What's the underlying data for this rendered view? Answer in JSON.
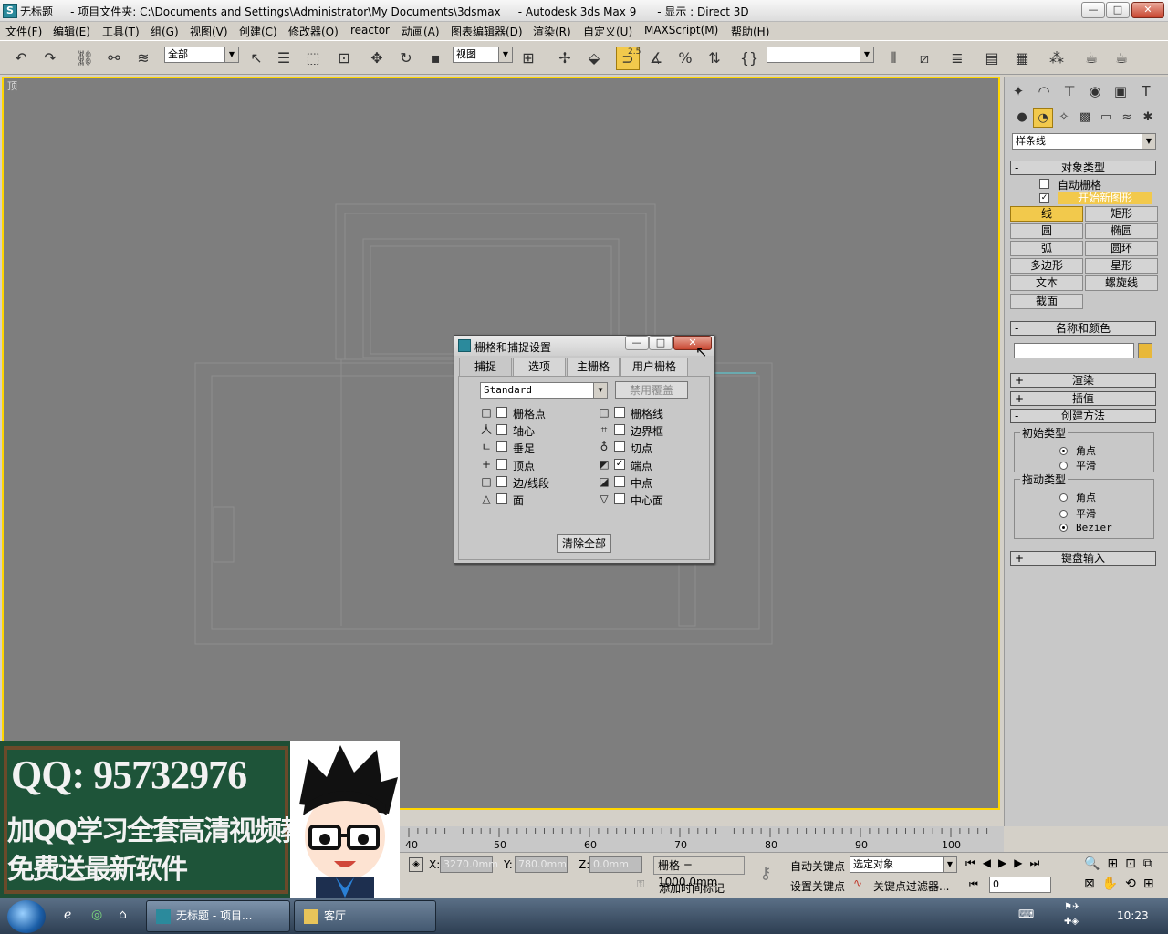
{
  "window": {
    "title": "无标题     - 项目文件夹: C:\\Documents and Settings\\Administrator\\My Documents\\3dsmax     - Autodesk 3ds Max 9      - 显示 : Direct 3D",
    "min": "—",
    "max": "□",
    "close": "✕"
  },
  "menu": [
    "文件(F)",
    "编辑(E)",
    "工具(T)",
    "组(G)",
    "视图(V)",
    "创建(C)",
    "修改器(O)",
    "reactor",
    "动画(A)",
    "图表编辑器(D)",
    "渲染(R)",
    "自定义(U)",
    "MAXScript(M)",
    "帮助(H)"
  ],
  "toolbar": {
    "selection_filter": "全部",
    "ref_coord": "视图",
    "named_sel": "",
    "snap_value": "2.5"
  },
  "viewport": {
    "label": "顶"
  },
  "dialog": {
    "title": "栅格和捕捉设置",
    "tabs": [
      "捕捉",
      "选项",
      "主栅格",
      "用户栅格"
    ],
    "combo": "Standard",
    "override_btn": "禁用覆盖",
    "left_items": [
      {
        "sym": "□",
        "label": "栅格点",
        "checked": false
      },
      {
        "sym": "人",
        "label": "轴心",
        "checked": false
      },
      {
        "sym": "ㄴ",
        "label": "垂足",
        "checked": false
      },
      {
        "sym": "+",
        "label": "顶点",
        "checked": false
      },
      {
        "sym": "□",
        "label": "边/线段",
        "checked": false
      },
      {
        "sym": "△",
        "label": "面",
        "checked": false
      }
    ],
    "right_items": [
      {
        "sym": "□",
        "label": "栅格线",
        "checked": false
      },
      {
        "sym": "⌗",
        "label": "边界框",
        "checked": false
      },
      {
        "sym": "♁",
        "label": "切点",
        "checked": false
      },
      {
        "sym": "◩",
        "label": "端点",
        "checked": true
      },
      {
        "sym": "◪",
        "label": "中点",
        "checked": false
      },
      {
        "sym": "▽",
        "label": "中心面",
        "checked": false
      }
    ],
    "clear_btn": "清除全部",
    "check_mark": "✓"
  },
  "cmd": {
    "dropdown": "样条线",
    "obj_type_header": "对象类型",
    "auto_grid": "自动栅格",
    "start_new_shape": "开始新图形",
    "buttons": [
      [
        "线",
        "矩形"
      ],
      [
        "圆",
        "椭圆"
      ],
      [
        "弧",
        "圆环"
      ],
      [
        "多边形",
        "星形"
      ],
      [
        "文本",
        "螺旋线"
      ],
      [
        "截面",
        ""
      ]
    ],
    "name_color": "名称和颜色",
    "render": "渲染",
    "interp": "插值",
    "create_method": "创建方法",
    "init_type": "初始类型",
    "drag_type": "拖动类型",
    "corner": "角点",
    "smooth": "平滑",
    "bezier": "Bezier",
    "keyboard": "键盘输入",
    "color": "#e8b83a",
    "minus": "-",
    "plus": "+"
  },
  "timeline": {
    "ticks": [
      "40",
      "50",
      "60",
      "70",
      "80",
      "90",
      "100"
    ]
  },
  "status": {
    "x_label": "X:",
    "x": "3270.0mm",
    "y_label": "Y:",
    "y": "780.0mm",
    "z_label": "Z:",
    "z": "0.0mm",
    "grid": "栅格 = 1000.0mm",
    "add_time_tag": "添加时间标记",
    "auto_key": "自动关键点",
    "set_key": "设置关键点",
    "selected": "选定对象",
    "key_filters": "关键点过滤器...",
    "frame": "0"
  },
  "ad": {
    "qq": "QQ: 95732976",
    "line2": "加QQ学习全套高清视频教程",
    "line3": "免费送最新软件"
  },
  "taskbar": {
    "task1": "无标题     - 项目...",
    "task2": "客厅",
    "clock": "10:23"
  }
}
